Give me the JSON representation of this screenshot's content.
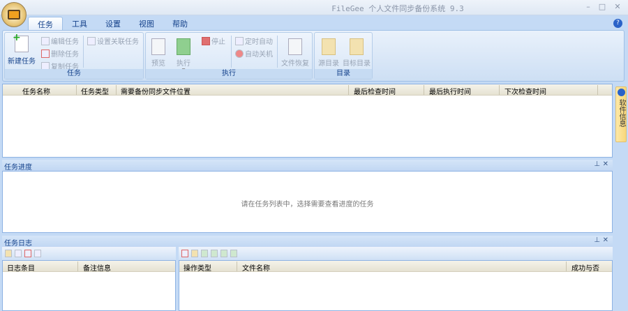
{
  "window": {
    "title": "FileGee 个人文件同步备份系统 9.3",
    "minimize": "–",
    "maximize": "□",
    "close": "✕"
  },
  "menu_tabs": [
    "任务",
    "工具",
    "设置",
    "视图",
    "帮助"
  ],
  "ribbon": {
    "task_group": {
      "label": "任务",
      "new_task": "新建任务",
      "edit_task": "编辑任务",
      "delete_task": "删除任务",
      "copy_task": "复制任务",
      "link_task": "设置关联任务"
    },
    "exec_group": {
      "label": "执行",
      "preview": "预览",
      "run": "执行",
      "stop": "停止",
      "timer_auto": "定时自动",
      "auto_shutdown": "自动关机",
      "file_restore": "文件恢复"
    },
    "dir_group": {
      "label": "目录",
      "source_dir": "源目录",
      "target_dir": "目标目录"
    }
  },
  "task_table": {
    "columns": [
      "任务名称",
      "任务类型",
      "需要备份同步文件位置",
      "最后检查时间",
      "最后执行时间",
      "下次检查时间"
    ]
  },
  "progress_panel": {
    "title": "任务进度",
    "message": "请在任务列表中，选择需要查看进度的任务"
  },
  "log_panel": {
    "title": "任务日志",
    "left_columns": [
      "日志条目",
      "备注信息"
    ],
    "right_columns": [
      "操作类型",
      "文件名称",
      "成功与否"
    ]
  },
  "side_tab": {
    "label": "软件信息"
  },
  "panel_controls": {
    "pin": "⊥",
    "close": "✕"
  }
}
